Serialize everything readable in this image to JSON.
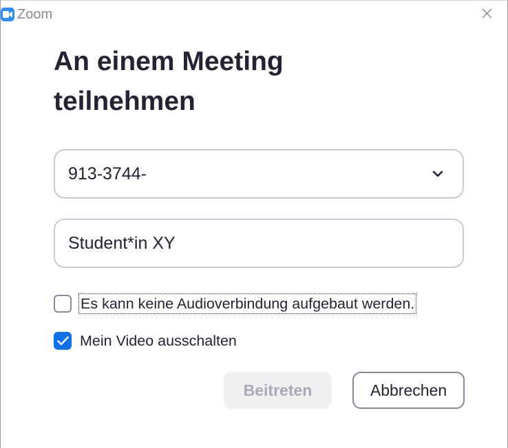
{
  "window": {
    "app_name": "Zoom",
    "icon": "zoom-camera-icon",
    "close_icon": "close-icon"
  },
  "heading": {
    "line1": "An einem Meeting",
    "line2": "teilnehmen"
  },
  "meeting_id_field": {
    "value": "913-3744-",
    "dropdown_icon": "chevron-down-icon"
  },
  "name_field": {
    "value": "Student*in XY"
  },
  "options": {
    "no_audio_label": "Es kann keine Audioverbindung aufgebaut werden.",
    "no_audio_checked": false,
    "video_off_label": "Mein Video ausschalten",
    "video_off_checked": true
  },
  "buttons": {
    "join_label": "Beitreten",
    "join_enabled": false,
    "cancel_label": "Abbrechen"
  },
  "colors": {
    "accent": "#0e71eb",
    "brand": "#2d8cff",
    "text": "#232333",
    "disabled_text": "#a9a9b6"
  }
}
